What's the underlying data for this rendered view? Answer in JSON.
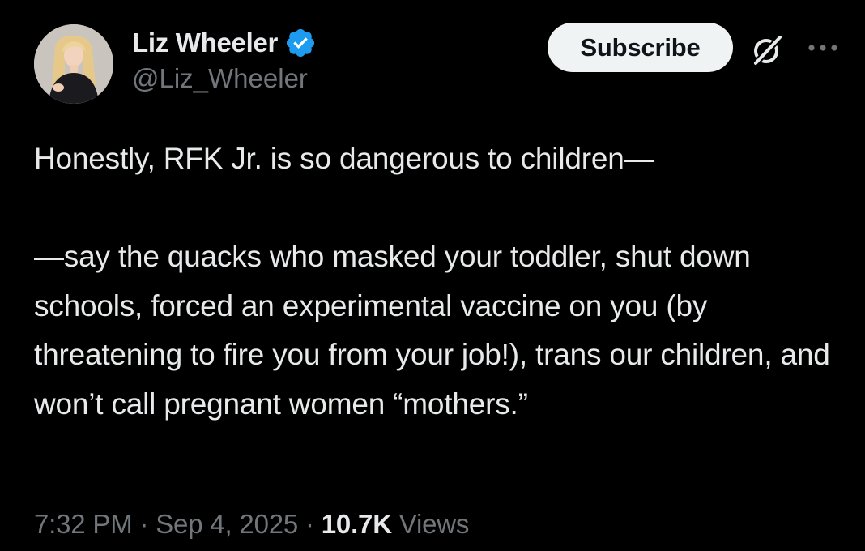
{
  "author": {
    "display_name": "Liz Wheeler",
    "handle": "@Liz_Wheeler",
    "verified": true,
    "avatar_icon": "profile-photo"
  },
  "actions": {
    "subscribe_label": "Subscribe",
    "grok_icon": "grok-icon",
    "more_icon": "more-options-icon"
  },
  "tweet": {
    "paragraphs": [
      "Honestly, RFK Jr. is so dangerous to children—",
      "—say the quacks who masked your toddler, shut down schools, forced an experimental vaccine on you (by threatening to fire you from your job!), trans our children, and won’t call pregnant women “mothers.”"
    ]
  },
  "meta": {
    "time": "7:32 PM",
    "separator": " · ",
    "date": "Sep 4, 2025",
    "views_count": "10.7K",
    "views_label": " Views"
  },
  "colors": {
    "background": "#000000",
    "text_primary": "#e7e9ea",
    "text_secondary": "#71767b",
    "verified_blue": "#1d9bf0",
    "button_bg": "#eff3f4"
  }
}
